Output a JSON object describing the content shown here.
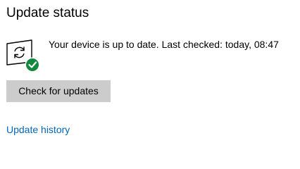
{
  "section": {
    "title": "Update status"
  },
  "status": {
    "icon": "update-sync-icon",
    "badge_icon": "checkmark-badge-icon",
    "message": "Your device is up to date. Last checked: today, 08:47"
  },
  "actions": {
    "check_label": "Check for updates",
    "history_label": "Update history"
  },
  "colors": {
    "button_bg": "#cccccc",
    "link": "#0067b8",
    "success": "#10893e",
    "text": "#000000"
  }
}
